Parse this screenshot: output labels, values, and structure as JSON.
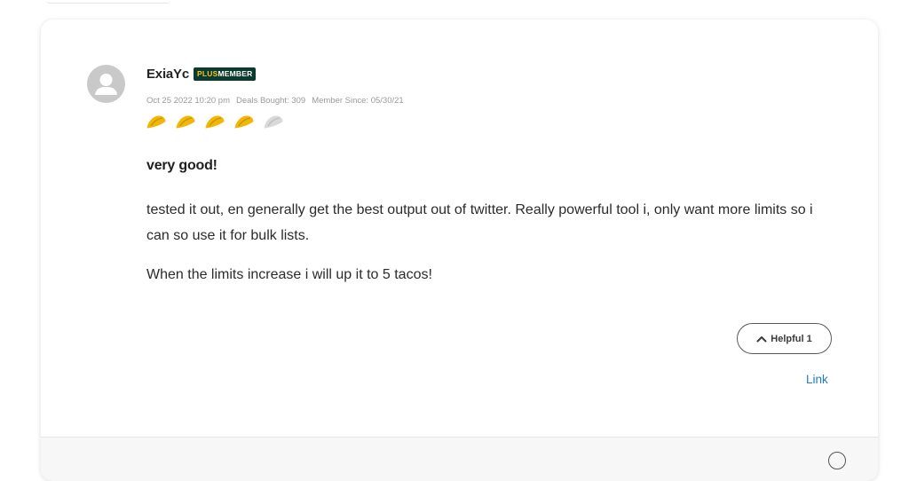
{
  "review": {
    "username": "ExiaYc",
    "badge": {
      "plus": "PLUS",
      "member": "MEMBER"
    },
    "meta": {
      "date": "Oct 25 2022 10:20 pm",
      "deals_bought": "Deals Bought: 309",
      "member_since": "Member Since: 05/30/21"
    },
    "rating": 4,
    "rating_max": 5,
    "title": "very good!",
    "paragraphs": [
      "tested it out, en generally get the best output out of twitter. Really powerful tool i, only want more limits so i can so use it for bulk lists.",
      "When the limits increase i will up it to 5 tacos!"
    ],
    "helpful_label": "Helpful 1",
    "link_label": "Link"
  },
  "colors": {
    "taco_filled": "#f2b705",
    "taco_empty": "#d9d9d9",
    "badge_bg": "#0b3b2e",
    "badge_plus": "#f5c518",
    "link": "#1f7ac9"
  },
  "icons": {
    "avatar": "user-silhouette-icon",
    "rating": "taco-icon",
    "helpful": "chevron-up-icon"
  }
}
